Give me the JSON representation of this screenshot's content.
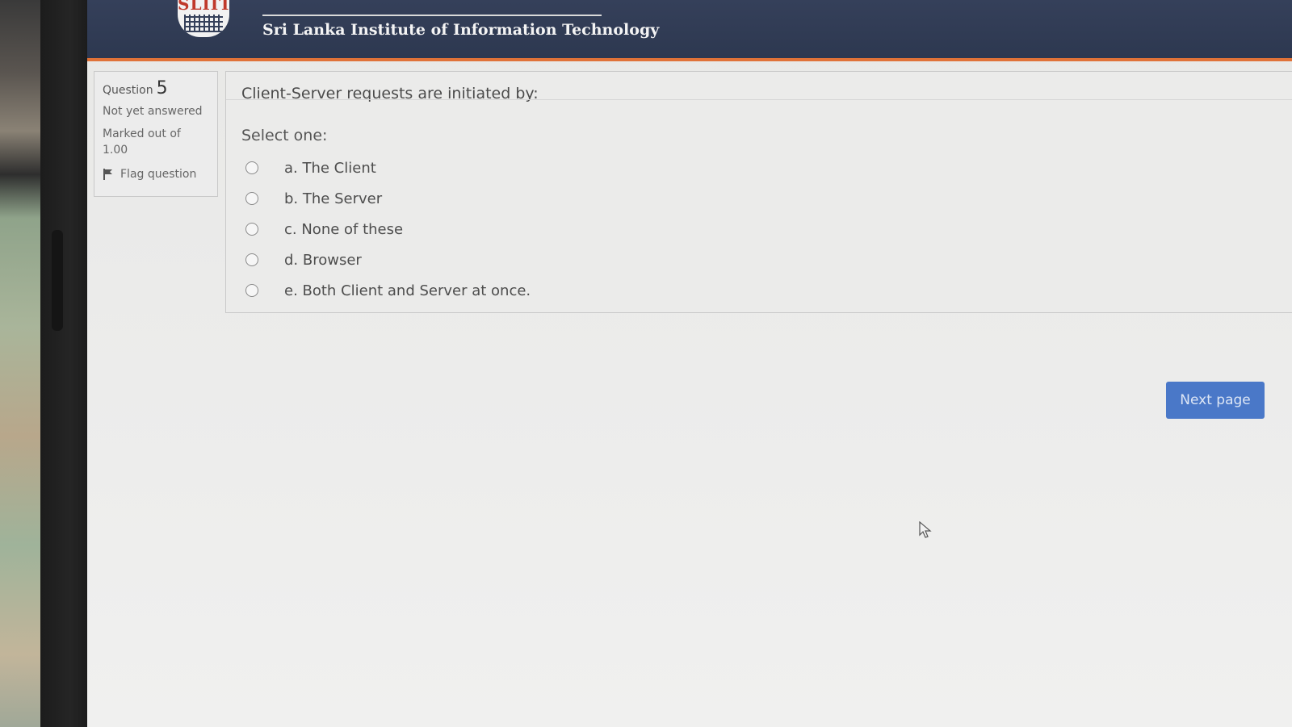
{
  "header": {
    "logo_text": "SLIIT",
    "institution_name": "Sri Lanka Institute of Information Technology"
  },
  "question_info": {
    "label": "Question",
    "number": "5",
    "state": "Not yet answered",
    "grade_line1": "Marked out of",
    "grade_line2": "1.00",
    "flag_label": "Flag question"
  },
  "question": {
    "text": "Client-Server requests are initiated by:",
    "prompt": "Select one:",
    "answers": [
      {
        "label": "a. The Client",
        "selected": false
      },
      {
        "label": "b. The Server",
        "selected": false
      },
      {
        "label": "c. None of these",
        "selected": false
      },
      {
        "label": "d. Browser",
        "selected": false
      },
      {
        "label": "e. Both Client and Server at once.",
        "selected": false
      }
    ]
  },
  "navigation": {
    "next_label": "Next page"
  },
  "colors": {
    "header_bg": "#35405a",
    "header_accent": "#e07238",
    "button_bg": "#4a78c8"
  }
}
